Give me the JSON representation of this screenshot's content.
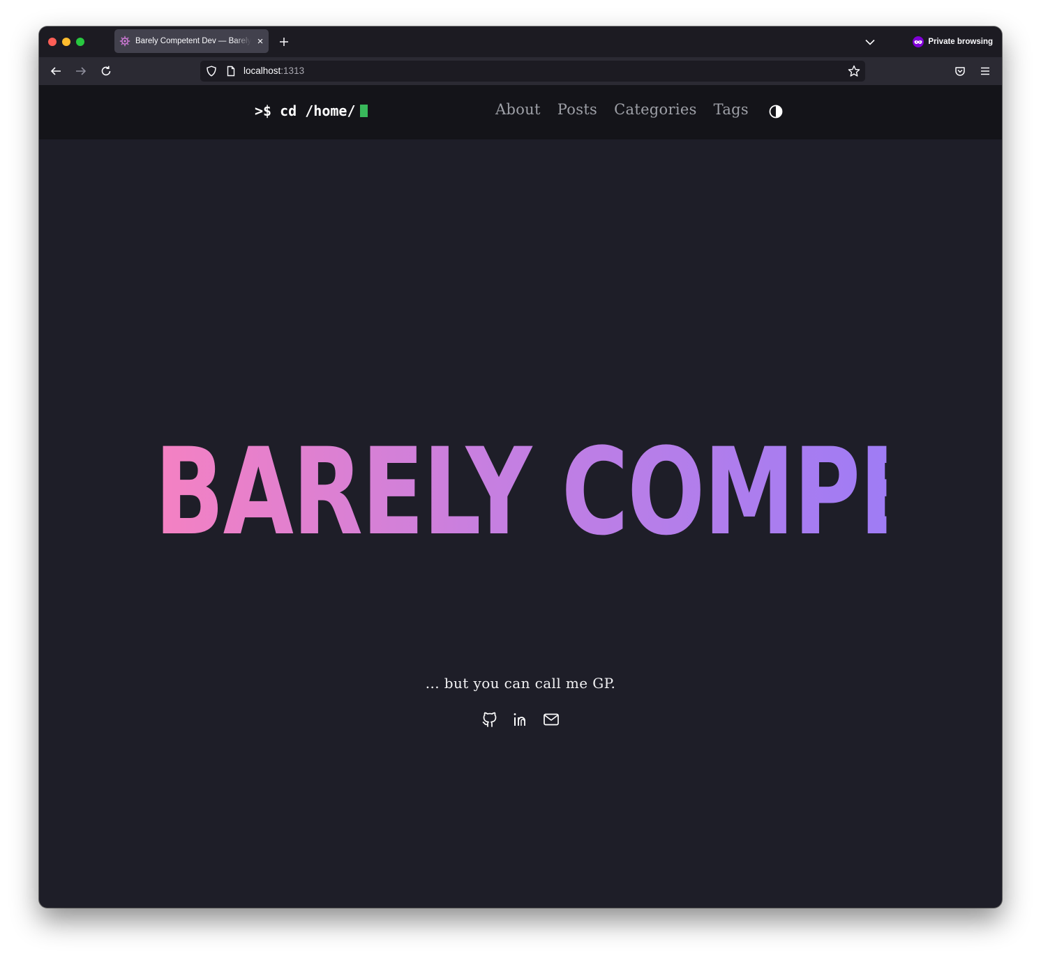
{
  "browser": {
    "tab": {
      "title": "Barely Competent Dev — Barely Competent Dev",
      "close_label": "×"
    },
    "new_tab_label": "+",
    "private_label": "Private browsing",
    "url": {
      "host": "localhost",
      "port": ":1313"
    }
  },
  "site": {
    "logo_text": ">$ cd /home/",
    "nav": [
      {
        "label": "About"
      },
      {
        "label": "Posts"
      },
      {
        "label": "Categories"
      },
      {
        "label": "Tags"
      }
    ],
    "hero_title": "BARELY COMPETENT",
    "tagline": "... but you can call me GP.",
    "social_icons": [
      "github-icon",
      "linkedin-icon",
      "mail-icon"
    ]
  },
  "colors": {
    "page_bg": "#1e1e28",
    "header_bg": "#141419",
    "cursor": "#39b95b",
    "gradient_start": "#f581c2",
    "gradient_end": "#9f7cf5",
    "private_badge": "#8000d7"
  }
}
